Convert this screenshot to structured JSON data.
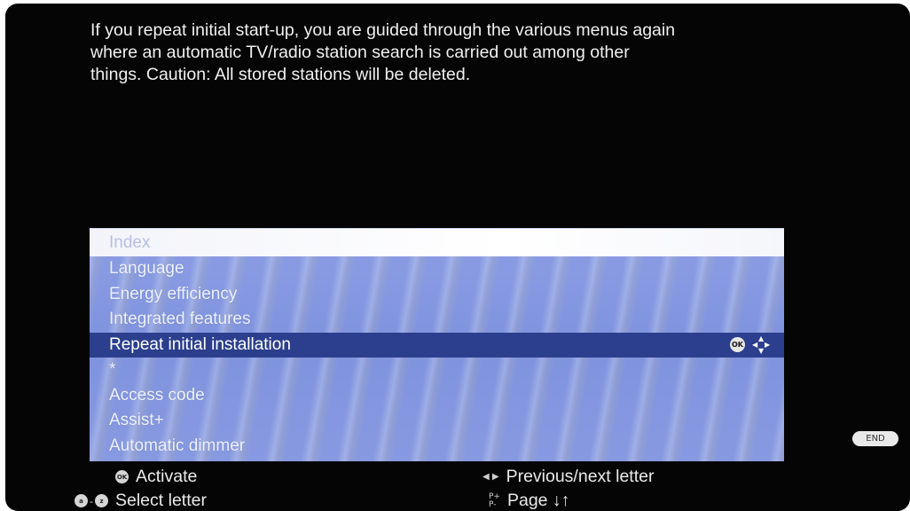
{
  "intro": {
    "line1": "If you repeat initial start-up, you are guided through the various menus again",
    "line2": "where an automatic TV/radio station search is carried out among other",
    "line3": "things. Caution: All stored stations will be deleted."
  },
  "menu": {
    "header": "Index",
    "items": [
      {
        "label": "Language"
      },
      {
        "label": "Energy efficiency"
      },
      {
        "label": "Integrated features"
      },
      {
        "label": "Repeat initial installation",
        "selected": true
      },
      {
        "label": "*"
      },
      {
        "label": "Access code"
      },
      {
        "label": "Assist+"
      },
      {
        "label": "Automatic dimmer"
      }
    ],
    "selected_icons": [
      "ok-icon",
      "dpad-icon"
    ]
  },
  "badges": {
    "end": "END",
    "ok": "OK",
    "a": "a",
    "z": "z",
    "p_plus": "P+",
    "p_minus": "P-"
  },
  "footer": {
    "activate": "Activate",
    "select_letter": "Select letter",
    "prev_next_letter": "Previous/next letter",
    "page": "Page ↓↑"
  },
  "colors": {
    "screen_bg": "#050505",
    "menu_bg": "#8c9ee4",
    "selected_bg": "#2c3f8e",
    "header_bg": "#ffffff"
  }
}
